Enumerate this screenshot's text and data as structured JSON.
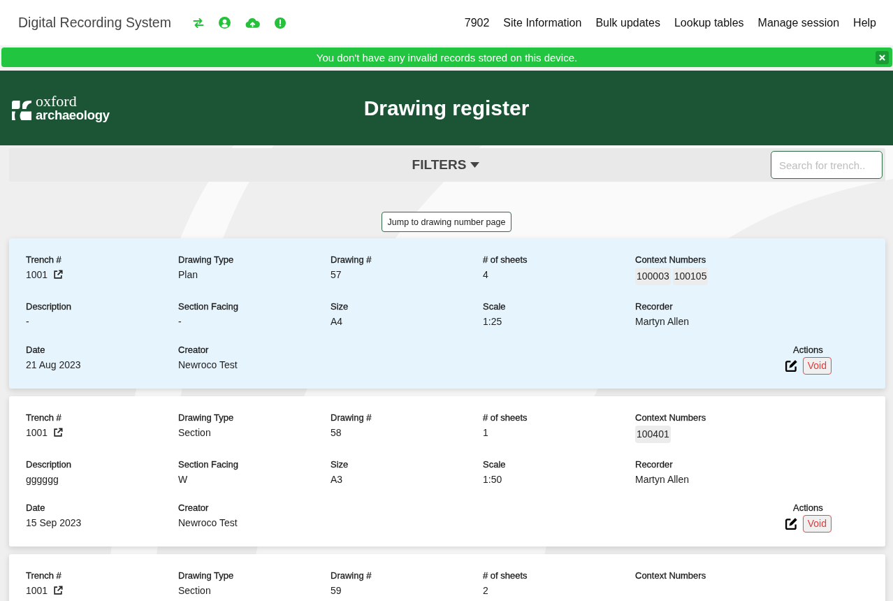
{
  "navbar": {
    "title": "Digital Recording System",
    "links": [
      "7902",
      "Site Information",
      "Bulk updates",
      "Lookup tables",
      "Manage session",
      "Help"
    ]
  },
  "alert": {
    "message": "You don't have any invalid records stored on this device."
  },
  "banner": {
    "logo": {
      "line_1": "oxford",
      "line_2": "archaeology"
    },
    "title": "Drawing register"
  },
  "filters": {
    "label": "FILTERS",
    "search": {
      "placeholder": "Search for trench.."
    }
  },
  "jump_button": "Jump to drawing number page",
  "records": [
    {
      "selected": true,
      "fields": [
        {
          "kind": "link",
          "label": "Trench #",
          "value": "1001"
        },
        {
          "kind": "text",
          "label": "Drawing Type",
          "value": "Plan"
        },
        {
          "kind": "text",
          "label": "Drawing #",
          "value": "57"
        },
        {
          "kind": "text",
          "label": "# of sheets",
          "value": "4"
        },
        {
          "kind": "chips",
          "label": "Context Numbers",
          "values": [
            "100003",
            "100105"
          ]
        },
        {
          "kind": "text",
          "label": "Description",
          "value": "-"
        },
        {
          "kind": "text",
          "label": "Section Facing",
          "value": "-"
        },
        {
          "kind": "text",
          "label": "Size",
          "value": "A4"
        },
        {
          "kind": "text",
          "label": "Scale",
          "value": "1:25"
        },
        {
          "kind": "text",
          "label": "Recorder",
          "value": "Martyn Allen"
        },
        {
          "kind": "text",
          "label": "Date",
          "value": "21 Aug 2023"
        },
        {
          "kind": "text",
          "label": "Creator",
          "value": "Newroco Test"
        }
      ],
      "actions": {
        "label": "Actions",
        "void": "Void"
      }
    },
    {
      "selected": false,
      "fields": [
        {
          "kind": "link",
          "label": "Trench #",
          "value": "1001"
        },
        {
          "kind": "text",
          "label": "Drawing Type",
          "value": "Section"
        },
        {
          "kind": "text",
          "label": "Drawing #",
          "value": "58"
        },
        {
          "kind": "text",
          "label": "# of sheets",
          "value": "1"
        },
        {
          "kind": "chips",
          "label": "Context Numbers",
          "values": [
            "100401"
          ]
        },
        {
          "kind": "text",
          "label": "Description",
          "value": "gggggg"
        },
        {
          "kind": "text",
          "label": "Section Facing",
          "value": "W"
        },
        {
          "kind": "text",
          "label": "Size",
          "value": "A3"
        },
        {
          "kind": "text",
          "label": "Scale",
          "value": "1:50"
        },
        {
          "kind": "text",
          "label": "Recorder",
          "value": "Martyn Allen"
        },
        {
          "kind": "text",
          "label": "Date",
          "value": "15 Sep 2023"
        },
        {
          "kind": "text",
          "label": "Creator",
          "value": "Newroco Test"
        }
      ],
      "actions": {
        "label": "Actions",
        "void": "Void"
      }
    },
    {
      "selected": false,
      "fields": [
        {
          "kind": "link",
          "label": "Trench #",
          "value": "1001"
        },
        {
          "kind": "text",
          "label": "Drawing Type",
          "value": "Section"
        },
        {
          "kind": "text",
          "label": "Drawing #",
          "value": "59"
        },
        {
          "kind": "text",
          "label": "# of sheets",
          "value": "2"
        },
        {
          "kind": "chips",
          "label": "Context Numbers"
        }
      ]
    }
  ]
}
